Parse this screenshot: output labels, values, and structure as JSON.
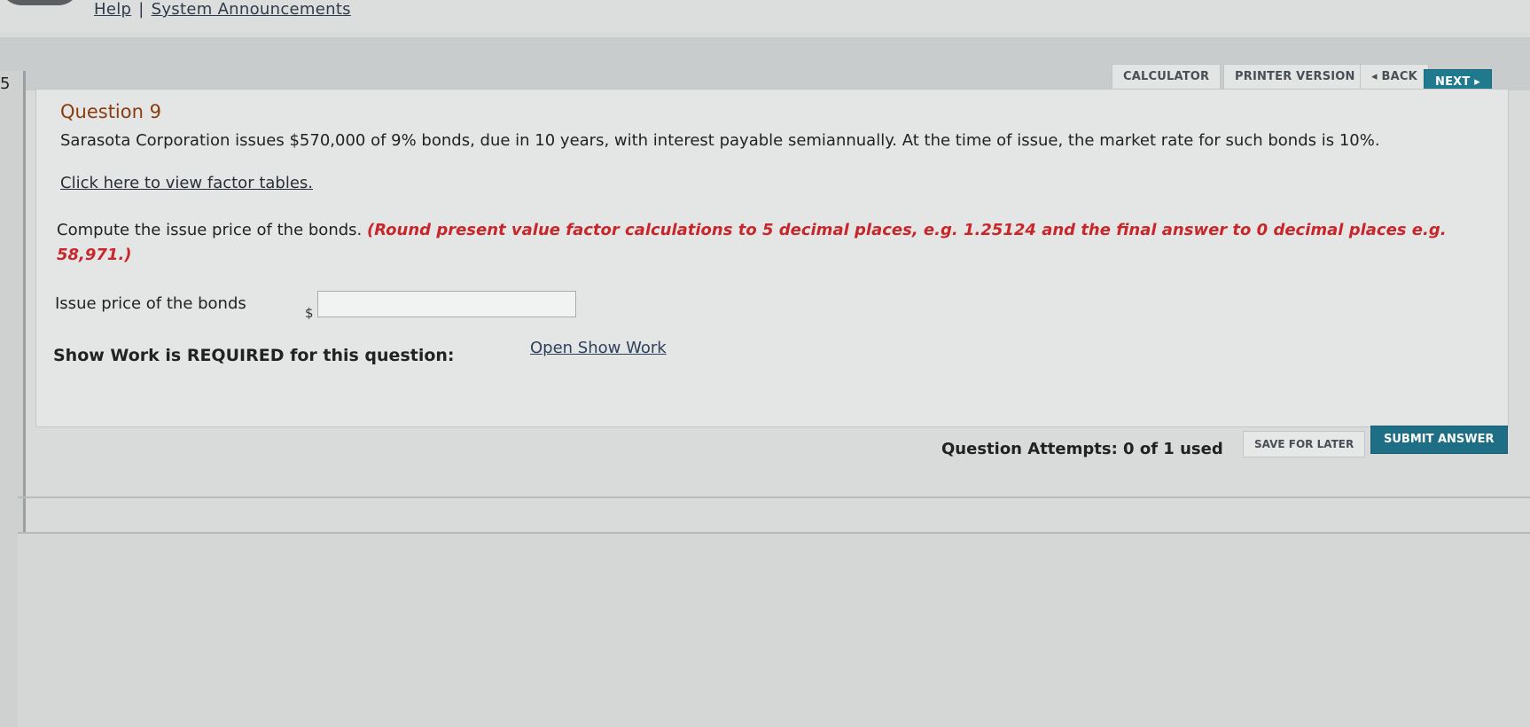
{
  "top_nav": {
    "help": "Help",
    "separator": "|",
    "announcements": "System Announcements"
  },
  "left_edge_digit": "5",
  "toolbar": {
    "calculator": "CALCULATOR",
    "printer": "PRINTER VERSION",
    "back": "BACK",
    "next": "NEXT"
  },
  "question": {
    "title": "Question 9",
    "text": "Sarasota Corporation issues $570,000 of 9% bonds, due in 10 years, with interest payable semiannually. At the time of issue, the market rate for such bonds is 10%.",
    "factor_link": "Click here to view factor tables.",
    "instruction": "Compute the issue price of the bonds.",
    "instruction_note": "(Round present value factor calculations to 5 decimal places, e.g. 1.25124 and the final answer to 0 decimal places e.g. 58,971.)",
    "input_label": "Issue price of the bonds",
    "currency": "$",
    "input_value": "",
    "show_work_label": "Show Work is REQUIRED for this question:",
    "show_work_link": "Open Show Work"
  },
  "footer": {
    "attempts": "Question Attempts: 0 of 1 used",
    "save_label": "SAVE FOR LATER",
    "submit_label": "SUBMIT ANSWER"
  },
  "colors": {
    "accent": "#1e6f86",
    "instruction_red": "#c8262b",
    "title_brown": "#8a3b10"
  }
}
